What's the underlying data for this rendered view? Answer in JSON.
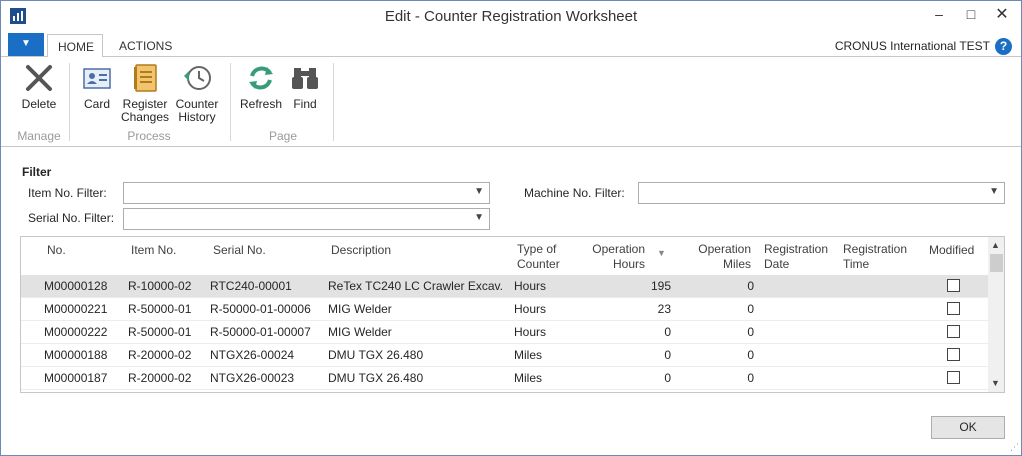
{
  "window": {
    "title": "Edit - Counter Registration Worksheet",
    "minimize": "–",
    "maximize": "□",
    "close": "✕"
  },
  "ribbon": {
    "tabs": [
      {
        "label": "HOME",
        "active": true
      },
      {
        "label": "ACTIONS",
        "active": false
      }
    ],
    "company": "CRONUS International TEST",
    "help": "?",
    "groups": [
      {
        "label": "Manage",
        "buttons": [
          {
            "label": "Delete",
            "icon": "delete-x-icon"
          }
        ]
      },
      {
        "label": "Process",
        "buttons": [
          {
            "label": "Card",
            "icon": "card-icon"
          },
          {
            "label": "Register\nChanges",
            "icon": "register-changes-icon"
          },
          {
            "label": "Counter\nHistory",
            "icon": "history-clock-icon"
          }
        ]
      },
      {
        "label": "Page",
        "buttons": [
          {
            "label": "Refresh",
            "icon": "refresh-icon"
          },
          {
            "label": "Find",
            "icon": "binoculars-icon"
          }
        ]
      }
    ]
  },
  "filter": {
    "title": "Filter",
    "item_no_label": "Item No. Filter:",
    "item_no_value": "",
    "serial_no_label": "Serial No. Filter:",
    "serial_no_value": "",
    "machine_no_label": "Machine No. Filter:",
    "machine_no_value": ""
  },
  "grid": {
    "columns": {
      "no": "No.",
      "item_no": "Item No.",
      "serial_no": "Serial No.",
      "description": "Description",
      "type_of_counter_1": "Type of",
      "type_of_counter_2": "Counter",
      "operation_hours_1": "Operation",
      "operation_hours_2": "Hours",
      "operation_miles_1": "Operation",
      "operation_miles_2": "Miles",
      "registration_date_1": "Registration",
      "registration_date_2": "Date",
      "registration_time_1": "Registration",
      "registration_time_2": "Time",
      "modified": "Modified"
    },
    "sort_indicator": "sort-descending-icon",
    "rows": [
      {
        "no": "M00000128",
        "item_no": "R-10000-02",
        "serial_no": "RTC240-00001",
        "description": "ReTex TC240 LC Crawler Excav.",
        "type": "Hours",
        "hours": "195",
        "miles": "0",
        "modified": false
      },
      {
        "no": "M00000221",
        "item_no": "R-50000-01",
        "serial_no": "R-50000-01-00006",
        "description": "MIG Welder",
        "type": "Hours",
        "hours": "23",
        "miles": "0",
        "modified": false
      },
      {
        "no": "M00000222",
        "item_no": "R-50000-01",
        "serial_no": "R-50000-01-00007",
        "description": "MIG Welder",
        "type": "Hours",
        "hours": "0",
        "miles": "0",
        "modified": false
      },
      {
        "no": "M00000188",
        "item_no": "R-20000-02",
        "serial_no": "NTGX26-00024",
        "description": "DMU TGX 26.480",
        "type": "Miles",
        "hours": "0",
        "miles": "0",
        "modified": false
      },
      {
        "no": "M00000187",
        "item_no": "R-20000-02",
        "serial_no": "NTGX26-00023",
        "description": "DMU TGX 26.480",
        "type": "Miles",
        "hours": "0",
        "miles": "0",
        "modified": false
      }
    ]
  },
  "ok_label": "OK",
  "colors": {
    "accent": "#1a6fc4",
    "selected_row": "#e2e2e2",
    "refresh_green": "#3a9a7c"
  }
}
